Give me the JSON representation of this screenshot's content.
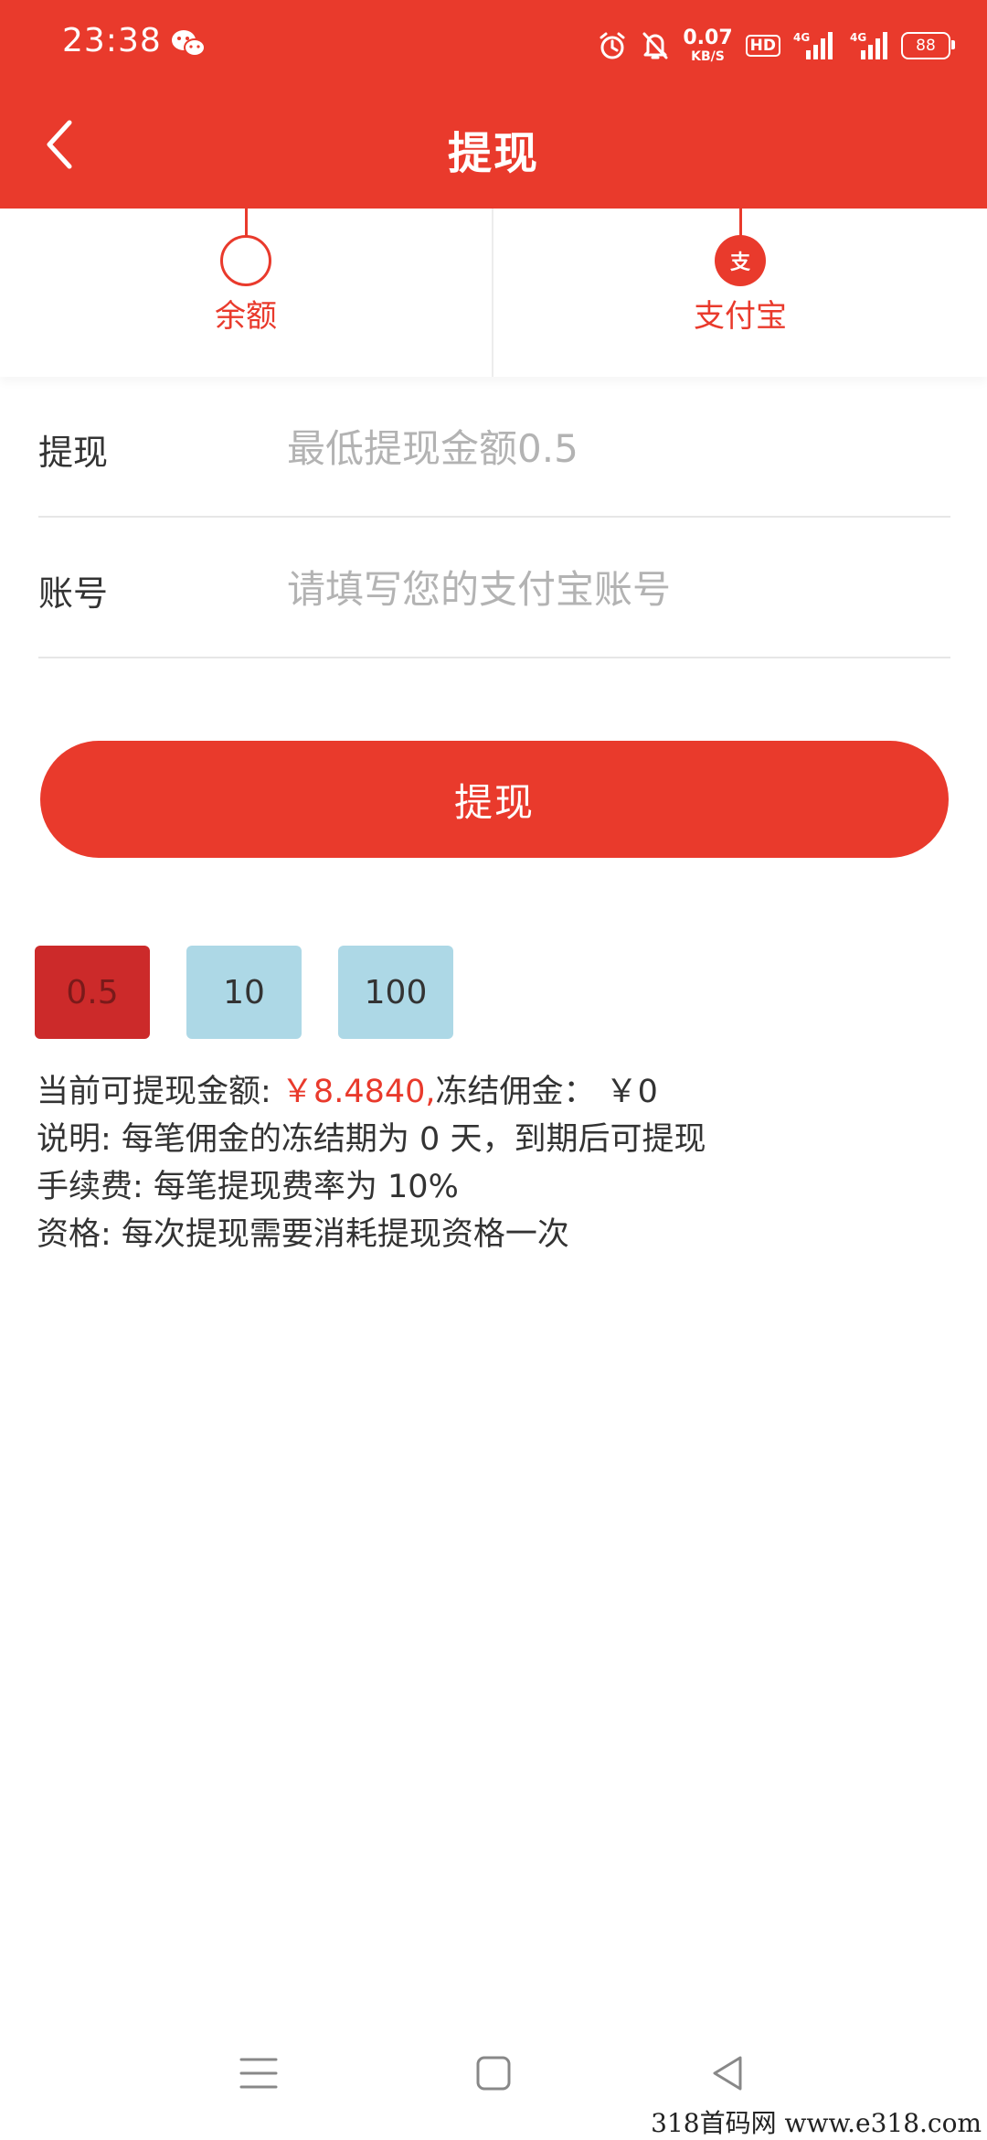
{
  "status_bar": {
    "time": "23:38",
    "net_speed": "0.07",
    "net_unit": "KB/S",
    "hd": "HD",
    "network": "4G",
    "battery": "88"
  },
  "nav": {
    "title": "提现"
  },
  "methods": [
    {
      "label": "余额",
      "selected": false
    },
    {
      "label": "支付宝",
      "selected": true,
      "icon_glyph": "支"
    }
  ],
  "form": {
    "amount_label": "提现",
    "amount_value": "",
    "amount_placeholder": "最低提现金额0.5",
    "account_label": "账号",
    "account_value": "",
    "account_placeholder": "请填写您的支付宝账号"
  },
  "submit_label": "提现",
  "presets": [
    {
      "label": "0.5",
      "active": true
    },
    {
      "label": "10",
      "active": false
    },
    {
      "label": "100",
      "active": false
    }
  ],
  "info": {
    "available_label": "当前可提现金额: ",
    "available_value": "￥8.4840,",
    "frozen_label": "冻结佣金：",
    "frozen_value": " ￥0",
    "note": "说明: 每笔佣金的冻结期为 0 天，到期后可提现",
    "fee": "手续费: 每笔提现费率为 10%",
    "qualification": "资格: 每次提现需要消耗提现资格一次"
  },
  "watermark": "318首码网  www.e318.com",
  "colors": {
    "primary": "#e93a2c",
    "chip": "#add8e6",
    "chip_active": "#cc2a2a",
    "placeholder": "#b3b3b3"
  },
  "icons": [
    "wechat-icon",
    "alarm-icon",
    "mute-icon",
    "signal-icon",
    "battery-icon",
    "back-icon",
    "menu-icon",
    "home-icon",
    "back-triangle-icon"
  ]
}
